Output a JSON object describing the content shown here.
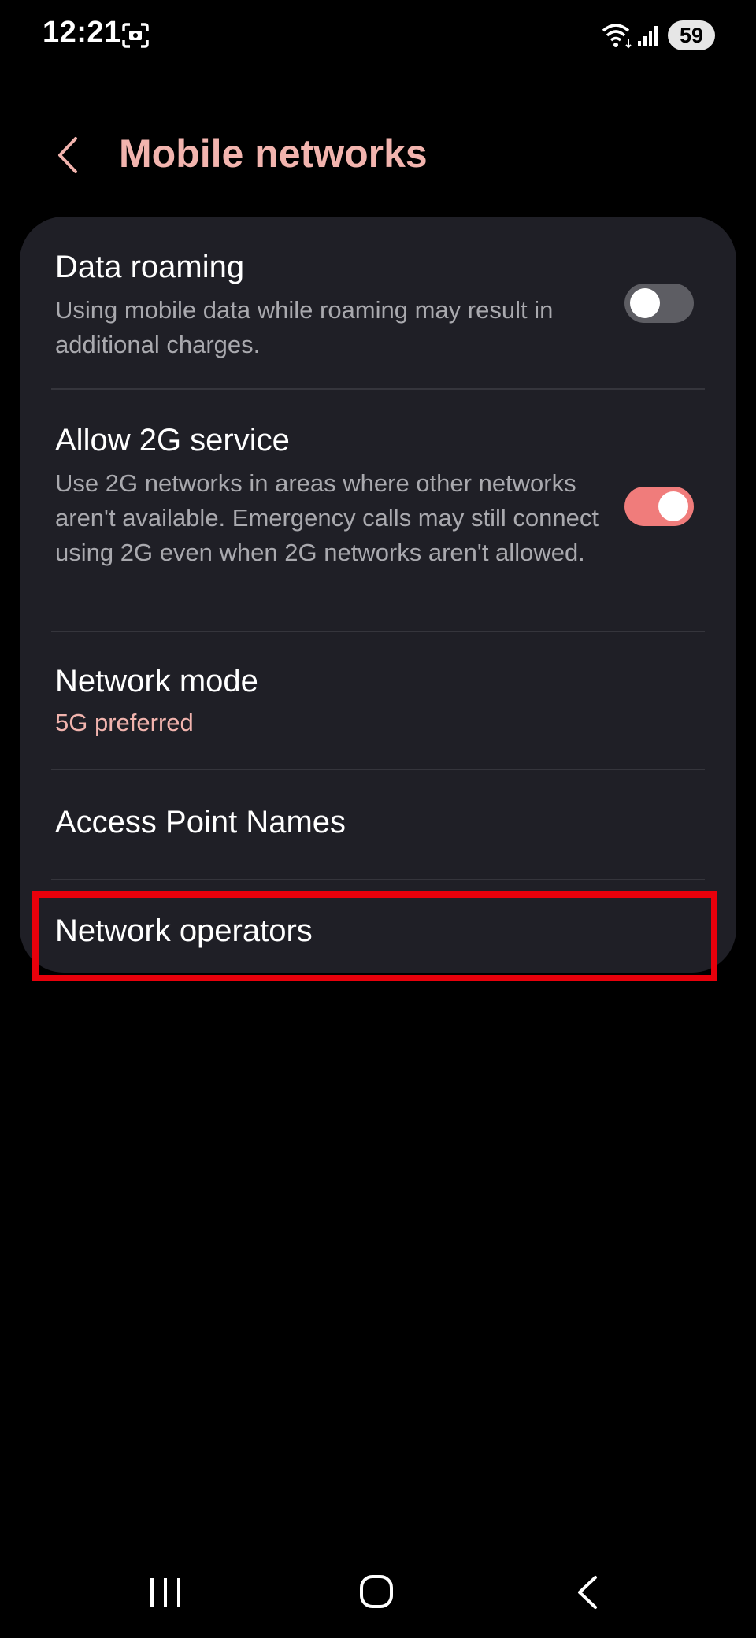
{
  "status_bar": {
    "time": "12:21",
    "battery": "59",
    "icons": [
      "screenshot-icon",
      "wifi-icon",
      "signal-icon"
    ]
  },
  "header": {
    "title": "Mobile networks",
    "back_icon": "chevron-left-icon"
  },
  "settings": {
    "data_roaming": {
      "title": "Data roaming",
      "description": "Using mobile data while roaming may result in additional charges.",
      "enabled": false
    },
    "allow_2g": {
      "title": "Allow 2G service",
      "description": "Use 2G networks in areas where other networks aren't available. Emergency calls may still connect using 2G even when 2G networks aren't allowed.",
      "enabled": true
    },
    "network_mode": {
      "title": "Network mode",
      "value": "5G preferred"
    },
    "access_point_names": {
      "title": "Access Point Names"
    },
    "network_operators": {
      "title": "Network operators",
      "highlighted": true
    }
  },
  "navigation": {
    "icons": [
      "recents-icon",
      "home-icon",
      "back-icon"
    ]
  },
  "colors": {
    "accent": "#f2b4ae",
    "toggle_on": "#f07c7b",
    "toggle_off": "#5d5d63",
    "card_background": "#1f1f26",
    "highlight": "#e8000b"
  }
}
